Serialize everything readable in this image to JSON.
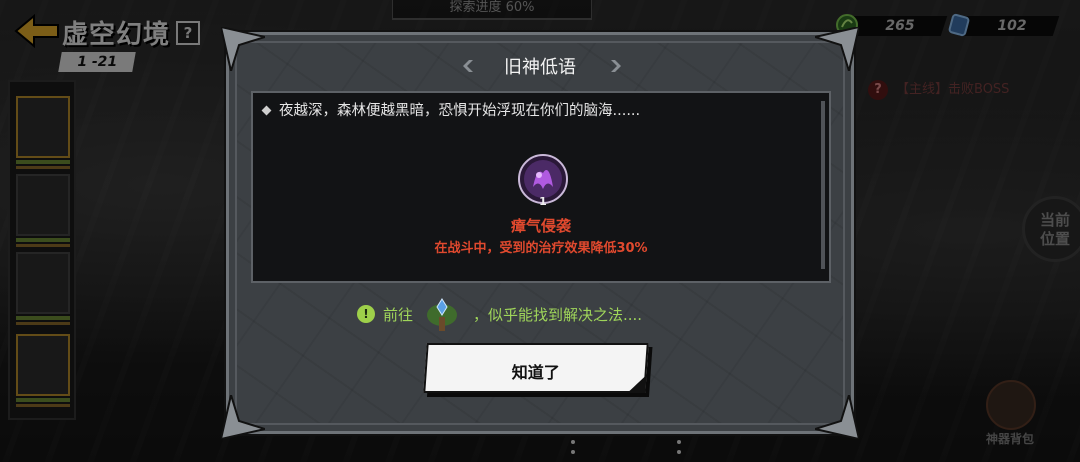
{
  "header": {
    "title": "虚空幻境",
    "stage": "1 -21",
    "explore_progress": "探索进度 60%"
  },
  "currencies": [
    {
      "icon": "green-gem-icon",
      "value": "265",
      "color": "#4f9e3a"
    },
    {
      "icon": "blue-crystal-icon",
      "value": "102",
      "color": "#4f86c6"
    }
  ],
  "quest": {
    "text": "【主线】击败BOSS"
  },
  "side_buttons": {
    "current_position": "当前\n位置",
    "artifact_bag": "神器背包"
  },
  "dialog": {
    "title": "旧神低语",
    "description": "夜越深，森林便越黑暗，恐惧开始浮现在你们的脑海......",
    "debuff": {
      "icon": "purple-miasma-icon",
      "stacks": "1",
      "name": "瘴气侵袭",
      "effect": "在战斗中，受到的治疗效果降低30%"
    },
    "hint": {
      "prefix": "前往",
      "icon": "crystal-tree-icon",
      "suffix": "，似乎能找到解决之法...."
    },
    "confirm_label": "知道了"
  },
  "colors": {
    "debuff_text": "#e0492e",
    "hint_text": "#9fd55a",
    "dialog_bg": "#3c4044"
  }
}
